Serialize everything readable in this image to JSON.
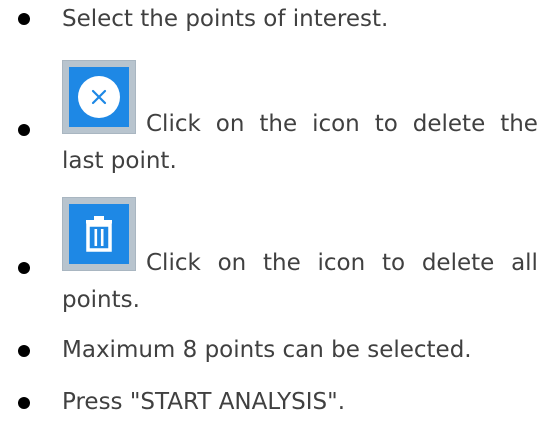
{
  "instructions": {
    "item1": {
      "text": "Select the points of interest."
    },
    "item2": {
      "icon": "close-circle-icon",
      "line1_words": [
        "Click",
        "on",
        "the",
        "icon",
        "to",
        "delete",
        "the"
      ],
      "line2": "last point."
    },
    "item3": {
      "icon": "trash-icon",
      "line1_words": [
        "Click",
        "on",
        "the",
        "icon",
        "to",
        "delete",
        "all"
      ],
      "line2": "points."
    },
    "item4": {
      "text": "Maximum 8 points can be selected."
    },
    "item5": {
      "text": "Press \"START ANALYSIS\"."
    }
  },
  "colors": {
    "icon_blue": "#1e88e5",
    "icon_frame": "#b8c4ce",
    "text": "#404040"
  }
}
